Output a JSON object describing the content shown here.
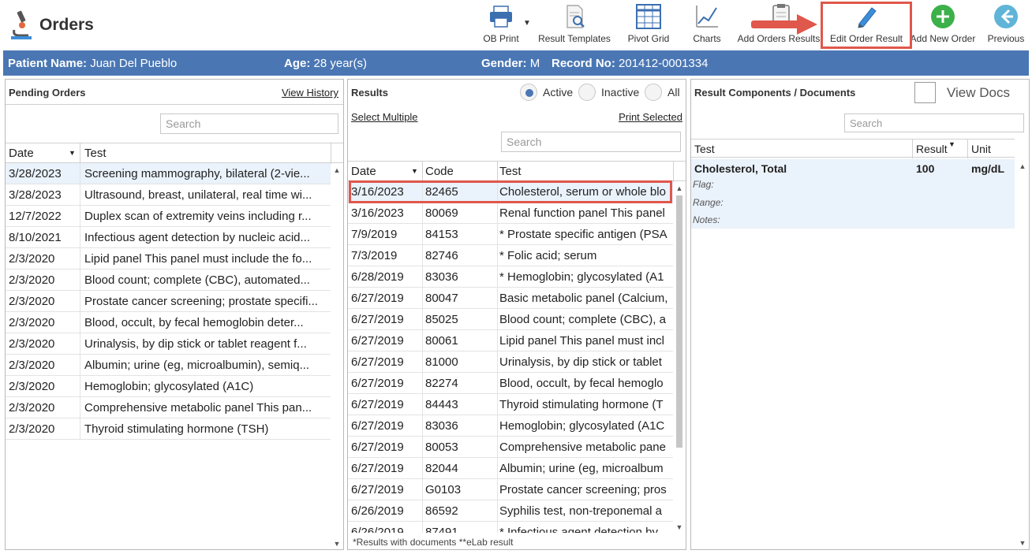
{
  "app": {
    "title": "Orders"
  },
  "toolbar": {
    "ob_print": "OB Print",
    "result_templates": "Result Templates",
    "pivot_grid": "Pivot Grid",
    "charts": "Charts",
    "add_orders_results": "Add Orders Results",
    "edit_order_result": "Edit Order Result",
    "add_new_order": "Add New Order",
    "previous": "Previous"
  },
  "patient": {
    "name_label": "Patient Name:",
    "name": "Juan Del Pueblo",
    "age_label": "Age:",
    "age": "28 year(s)",
    "gender_label": "Gender:",
    "gender": "M",
    "record_label": "Record No:",
    "record": "201412-0001334"
  },
  "pending": {
    "title": "Pending Orders",
    "view_history": "View History",
    "search_placeholder": "Search",
    "col_date": "Date",
    "col_test": "Test",
    "rows": [
      {
        "date": "3/28/2023",
        "test": "Screening mammography, bilateral (2-vie..."
      },
      {
        "date": "3/28/2023",
        "test": "Ultrasound, breast, unilateral, real time wi..."
      },
      {
        "date": "12/7/2022",
        "test": "Duplex scan of extremity veins including r..."
      },
      {
        "date": "8/10/2021",
        "test": "Infectious agent detection by nucleic acid..."
      },
      {
        "date": "2/3/2020",
        "test": "Lipid panel This panel must include the fo..."
      },
      {
        "date": "2/3/2020",
        "test": "Blood count; complete (CBC), automated..."
      },
      {
        "date": "2/3/2020",
        "test": "Prostate cancer screening; prostate specifi..."
      },
      {
        "date": "2/3/2020",
        "test": "Blood, occult, by fecal hemoglobin deter..."
      },
      {
        "date": "2/3/2020",
        "test": "Urinalysis, by dip stick or tablet reagent f..."
      },
      {
        "date": "2/3/2020",
        "test": "Albumin; urine (eg, microalbumin), semiq..."
      },
      {
        "date": "2/3/2020",
        "test": "Hemoglobin; glycosylated (A1C)"
      },
      {
        "date": "2/3/2020",
        "test": "Comprehensive metabolic panel This pan..."
      },
      {
        "date": "2/3/2020",
        "test": "Thyroid stimulating hormone (TSH)"
      }
    ]
  },
  "results": {
    "title": "Results",
    "radio_active": "Active",
    "radio_inactive": "Inactive",
    "radio_all": "All",
    "select_multiple": "Select Multiple",
    "print_selected": "Print Selected",
    "search_placeholder": "Search",
    "col_date": "Date",
    "col_code": "Code",
    "col_test": "Test",
    "rows": [
      {
        "date": "3/16/2023",
        "code": "82465",
        "test": "Cholesterol, serum or whole blo"
      },
      {
        "date": "3/16/2023",
        "code": "80069",
        "test": "Renal function panel This panel"
      },
      {
        "date": "7/9/2019",
        "code": "84153",
        "test": "* Prostate specific antigen (PSA"
      },
      {
        "date": "7/3/2019",
        "code": "82746",
        "test": "* Folic acid; serum"
      },
      {
        "date": "6/28/2019",
        "code": "83036",
        "test": "* Hemoglobin; glycosylated (A1"
      },
      {
        "date": "6/27/2019",
        "code": "80047",
        "test": "Basic metabolic panel (Calcium,"
      },
      {
        "date": "6/27/2019",
        "code": "85025",
        "test": "Blood count; complete (CBC), a"
      },
      {
        "date": "6/27/2019",
        "code": "80061",
        "test": "Lipid panel This panel must incl"
      },
      {
        "date": "6/27/2019",
        "code": "81000",
        "test": "Urinalysis, by dip stick or tablet"
      },
      {
        "date": "6/27/2019",
        "code": "82274",
        "test": "Blood, occult, by fecal hemoglo"
      },
      {
        "date": "6/27/2019",
        "code": "84443",
        "test": "Thyroid stimulating hormone (T"
      },
      {
        "date": "6/27/2019",
        "code": "83036",
        "test": "Hemoglobin; glycosylated (A1C"
      },
      {
        "date": "6/27/2019",
        "code": "80053",
        "test": "Comprehensive metabolic pane"
      },
      {
        "date": "6/27/2019",
        "code": "82044",
        "test": "Albumin; urine (eg, microalbum"
      },
      {
        "date": "6/27/2019",
        "code": "G0103",
        "test": "Prostate cancer screening; pros"
      },
      {
        "date": "6/26/2019",
        "code": "86592",
        "test": "Syphilis test, non-treponemal a"
      },
      {
        "date": "6/26/2019",
        "code": "87491",
        "test": "* Infectious agent detection by"
      }
    ],
    "footer": "*Results with documents    **eLab result"
  },
  "components": {
    "title": "Result Components / Documents",
    "view_docs": "View Docs",
    "search_placeholder": "Search",
    "col_test": "Test",
    "col_result": "Result",
    "col_unit": "Unit",
    "row": {
      "test": "Cholesterol, Total",
      "result": "100",
      "unit": "mg/dL"
    },
    "flag_label": "Flag:",
    "range_label": "Range:",
    "notes_label": "Notes:"
  },
  "colors": {
    "accent": "#4a77b4",
    "highlight": "#e0574b",
    "selected_row": "#eaf2fb"
  }
}
